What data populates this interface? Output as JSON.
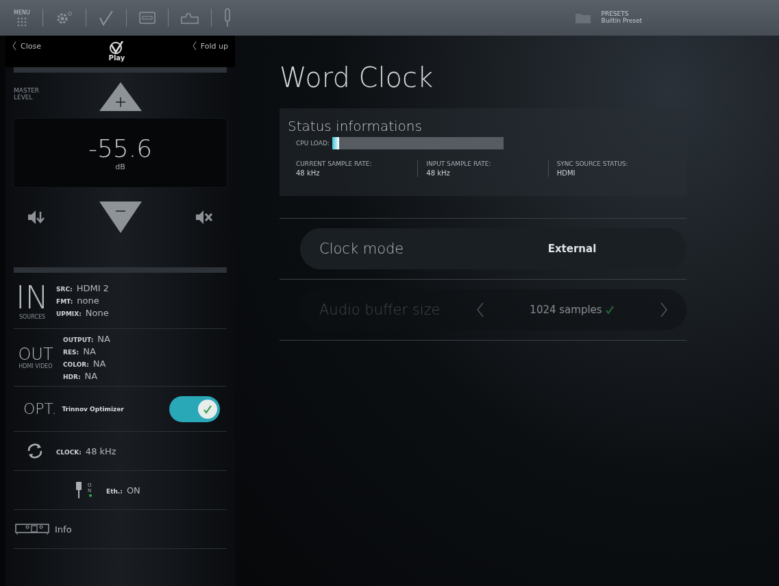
{
  "top_bar": {
    "menu_label": "MENU",
    "presets": {
      "label": "PRESETS",
      "value": "Builtin Preset"
    }
  },
  "sidebar": {
    "close": "Close",
    "fold_up": "Fold up",
    "logo": "Play",
    "master": {
      "label": "MASTER LEVEL",
      "value": "-55.6",
      "unit": "dB"
    },
    "in": {
      "title": "IN",
      "subtitle": "SOURCES",
      "rows": [
        {
          "key": "SRC:",
          "value": "HDMI 2"
        },
        {
          "key": "FMT:",
          "value": "none"
        },
        {
          "key": "UPMIX:",
          "value": "None"
        }
      ]
    },
    "out": {
      "title": "OUT",
      "subtitle": "HDMI VIDEO",
      "rows": [
        {
          "key": "OUTPUT:",
          "value": "NA"
        },
        {
          "key": "RES:",
          "value": "NA"
        },
        {
          "key": "COLOR:",
          "value": "NA"
        },
        {
          "key": "HDR:",
          "value": "NA"
        }
      ]
    },
    "opt": {
      "title": "OPT.",
      "label": "Trinnov Optimizer",
      "on": true
    },
    "clock": {
      "key": "CLOCK:",
      "value": "48 kHz"
    },
    "ethernet": {
      "badge": "ON",
      "key": "Eth.:",
      "value": "ON"
    },
    "info": {
      "label": "Info"
    }
  },
  "page": {
    "title": "Word Clock",
    "status": {
      "title": "Status informations",
      "cpu_label": "CPU LOAD:",
      "cpu": {
        "level": 0.04
      },
      "items": [
        {
          "label": "CURRENT SAMPLE RATE:",
          "value": "48 kHz"
        },
        {
          "label": "INPUT SAMPLE RATE:",
          "value": "48 kHz"
        },
        {
          "label": "SYNC SOURCE STATUS:",
          "value": "HDMI"
        }
      ]
    },
    "settings": [
      {
        "kind": "select",
        "label": "Clock mode",
        "value": "External",
        "disabled": false
      },
      {
        "kind": "stepper",
        "label": "Audio buffer size",
        "value": "1024 samples",
        "disabled": true
      }
    ]
  }
}
